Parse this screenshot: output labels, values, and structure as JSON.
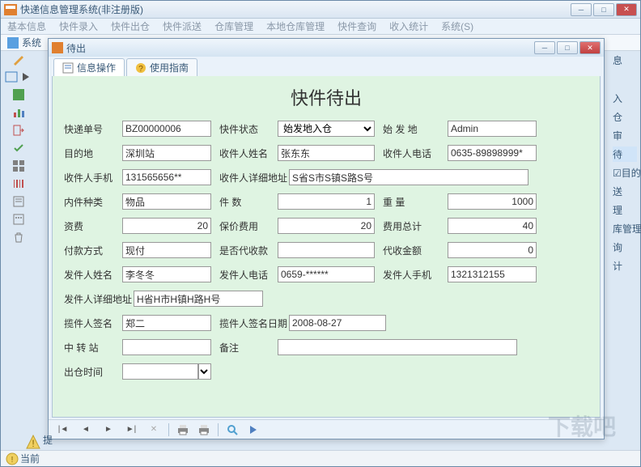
{
  "outer": {
    "title": "快递信息管理系统(非注册版)",
    "win_min": "─",
    "win_max": "□",
    "win_close": "✕"
  },
  "menu": [
    "基本信息",
    "快件录入",
    "快件出仓",
    "快件派送",
    "仓库管理",
    "本地仓库管理",
    "快件查询",
    "收入统计",
    "系统(S)"
  ],
  "sub": {
    "sys_label": "系统"
  },
  "right_list": [
    "息",
    "入",
    "仓",
    "审",
    "待",
    "☑目的",
    "送",
    "理",
    "库管理",
    "询",
    "计"
  ],
  "inner": {
    "title": "待出",
    "win_min": "─",
    "win_max": "□",
    "win_close": "✕",
    "tabs": [
      {
        "label": "信息操作"
      },
      {
        "label": "使用指南"
      }
    ]
  },
  "form": {
    "heading": "快件待出",
    "labels": {
      "express_no": "快递单号",
      "status": "快件状态",
      "origin": "始   发   地",
      "dest": "目的地",
      "recv_name": "收件人姓名",
      "recv_phone": "收件人电话",
      "recv_mobile": "收件人手机",
      "recv_addr": "收件人详细地址",
      "item_type": "内件种类",
      "qty": "件      数",
      "weight": "重       量",
      "fee": "资费",
      "insure": "保价费用",
      "total": "费用总计",
      "pay_method": "付款方式",
      "is_cod": "是否代收款",
      "cod_amount": "代收金额",
      "sender_name": "发件人姓名",
      "sender_phone": "发件人电话",
      "sender_mobile": "发件人手机",
      "sender_addr": "发件人详细地址",
      "handler_sign": "揽件人签名",
      "handler_date": "揽件人签名日期",
      "transfer": "中  转  站",
      "remark": "备注",
      "out_time": "出仓时间"
    },
    "values": {
      "express_no": "BZ00000006",
      "status": "始发地入仓",
      "origin": "Admin",
      "dest": "深圳站",
      "recv_name": "张东东",
      "recv_phone": "0635-89898999*",
      "recv_mobile": "131565656**",
      "recv_addr": "S省S市S镇S路S号",
      "item_type": "物品",
      "qty": "1",
      "weight": "1000",
      "fee": "20",
      "insure": "20",
      "total": "40",
      "pay_method": "现付",
      "is_cod": "",
      "cod_amount": "0",
      "sender_name": "李冬冬",
      "sender_phone": "0659-******",
      "sender_mobile": "1321312155",
      "sender_addr": "H省H市H镇H路H号",
      "handler_sign": "郑二",
      "handler_date": "2008-08-27",
      "transfer": "",
      "remark": "",
      "out_time": ""
    }
  },
  "bottom_nav": {
    "first": "|◄",
    "prev": "◄",
    "next": "►",
    "last": "►|",
    "stop": "✕"
  },
  "status": {
    "hint_label": "提",
    "current_label": "当前"
  },
  "watermark": "下载吧"
}
